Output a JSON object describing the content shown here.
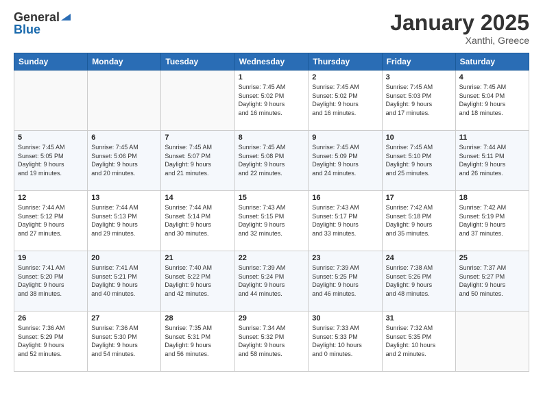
{
  "logo": {
    "general": "General",
    "blue": "Blue"
  },
  "header": {
    "month": "January 2025",
    "location": "Xanthi, Greece"
  },
  "weekdays": [
    "Sunday",
    "Monday",
    "Tuesday",
    "Wednesday",
    "Thursday",
    "Friday",
    "Saturday"
  ],
  "weeks": [
    [
      {
        "day": "",
        "info": ""
      },
      {
        "day": "",
        "info": ""
      },
      {
        "day": "",
        "info": ""
      },
      {
        "day": "1",
        "info": "Sunrise: 7:45 AM\nSunset: 5:02 PM\nDaylight: 9 hours\nand 16 minutes."
      },
      {
        "day": "2",
        "info": "Sunrise: 7:45 AM\nSunset: 5:02 PM\nDaylight: 9 hours\nand 16 minutes."
      },
      {
        "day": "3",
        "info": "Sunrise: 7:45 AM\nSunset: 5:03 PM\nDaylight: 9 hours\nand 17 minutes."
      },
      {
        "day": "4",
        "info": "Sunrise: 7:45 AM\nSunset: 5:04 PM\nDaylight: 9 hours\nand 18 minutes."
      }
    ],
    [
      {
        "day": "5",
        "info": "Sunrise: 7:45 AM\nSunset: 5:05 PM\nDaylight: 9 hours\nand 19 minutes."
      },
      {
        "day": "6",
        "info": "Sunrise: 7:45 AM\nSunset: 5:06 PM\nDaylight: 9 hours\nand 20 minutes."
      },
      {
        "day": "7",
        "info": "Sunrise: 7:45 AM\nSunset: 5:07 PM\nDaylight: 9 hours\nand 21 minutes."
      },
      {
        "day": "8",
        "info": "Sunrise: 7:45 AM\nSunset: 5:08 PM\nDaylight: 9 hours\nand 22 minutes."
      },
      {
        "day": "9",
        "info": "Sunrise: 7:45 AM\nSunset: 5:09 PM\nDaylight: 9 hours\nand 24 minutes."
      },
      {
        "day": "10",
        "info": "Sunrise: 7:45 AM\nSunset: 5:10 PM\nDaylight: 9 hours\nand 25 minutes."
      },
      {
        "day": "11",
        "info": "Sunrise: 7:44 AM\nSunset: 5:11 PM\nDaylight: 9 hours\nand 26 minutes."
      }
    ],
    [
      {
        "day": "12",
        "info": "Sunrise: 7:44 AM\nSunset: 5:12 PM\nDaylight: 9 hours\nand 27 minutes."
      },
      {
        "day": "13",
        "info": "Sunrise: 7:44 AM\nSunset: 5:13 PM\nDaylight: 9 hours\nand 29 minutes."
      },
      {
        "day": "14",
        "info": "Sunrise: 7:44 AM\nSunset: 5:14 PM\nDaylight: 9 hours\nand 30 minutes."
      },
      {
        "day": "15",
        "info": "Sunrise: 7:43 AM\nSunset: 5:15 PM\nDaylight: 9 hours\nand 32 minutes."
      },
      {
        "day": "16",
        "info": "Sunrise: 7:43 AM\nSunset: 5:17 PM\nDaylight: 9 hours\nand 33 minutes."
      },
      {
        "day": "17",
        "info": "Sunrise: 7:42 AM\nSunset: 5:18 PM\nDaylight: 9 hours\nand 35 minutes."
      },
      {
        "day": "18",
        "info": "Sunrise: 7:42 AM\nSunset: 5:19 PM\nDaylight: 9 hours\nand 37 minutes."
      }
    ],
    [
      {
        "day": "19",
        "info": "Sunrise: 7:41 AM\nSunset: 5:20 PM\nDaylight: 9 hours\nand 38 minutes."
      },
      {
        "day": "20",
        "info": "Sunrise: 7:41 AM\nSunset: 5:21 PM\nDaylight: 9 hours\nand 40 minutes."
      },
      {
        "day": "21",
        "info": "Sunrise: 7:40 AM\nSunset: 5:22 PM\nDaylight: 9 hours\nand 42 minutes."
      },
      {
        "day": "22",
        "info": "Sunrise: 7:39 AM\nSunset: 5:24 PM\nDaylight: 9 hours\nand 44 minutes."
      },
      {
        "day": "23",
        "info": "Sunrise: 7:39 AM\nSunset: 5:25 PM\nDaylight: 9 hours\nand 46 minutes."
      },
      {
        "day": "24",
        "info": "Sunrise: 7:38 AM\nSunset: 5:26 PM\nDaylight: 9 hours\nand 48 minutes."
      },
      {
        "day": "25",
        "info": "Sunrise: 7:37 AM\nSunset: 5:27 PM\nDaylight: 9 hours\nand 50 minutes."
      }
    ],
    [
      {
        "day": "26",
        "info": "Sunrise: 7:36 AM\nSunset: 5:29 PM\nDaylight: 9 hours\nand 52 minutes."
      },
      {
        "day": "27",
        "info": "Sunrise: 7:36 AM\nSunset: 5:30 PM\nDaylight: 9 hours\nand 54 minutes."
      },
      {
        "day": "28",
        "info": "Sunrise: 7:35 AM\nSunset: 5:31 PM\nDaylight: 9 hours\nand 56 minutes."
      },
      {
        "day": "29",
        "info": "Sunrise: 7:34 AM\nSunset: 5:32 PM\nDaylight: 9 hours\nand 58 minutes."
      },
      {
        "day": "30",
        "info": "Sunrise: 7:33 AM\nSunset: 5:33 PM\nDaylight: 10 hours\nand 0 minutes."
      },
      {
        "day": "31",
        "info": "Sunrise: 7:32 AM\nSunset: 5:35 PM\nDaylight: 10 hours\nand 2 minutes."
      },
      {
        "day": "",
        "info": ""
      }
    ]
  ]
}
